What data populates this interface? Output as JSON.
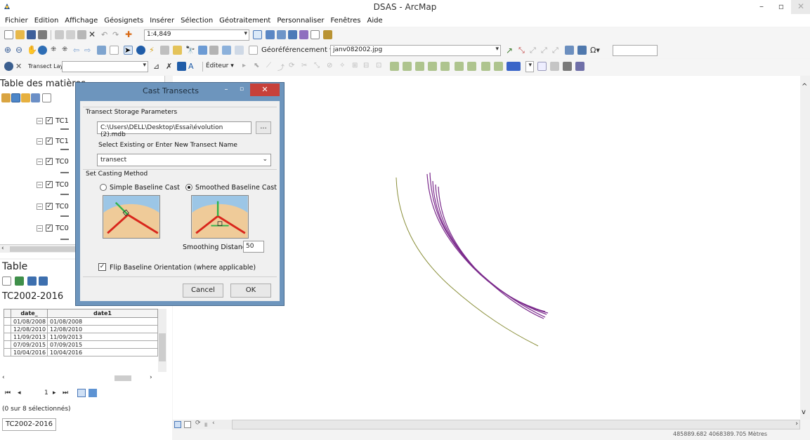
{
  "window": {
    "title": "DSAS - ArcMap",
    "minimize": "–",
    "maximize": "▫",
    "close": "✕"
  },
  "menu": [
    "Fichier",
    "Edition",
    "Affichage",
    "Géosignets",
    "Insérer",
    "Sélection",
    "Géotraitement",
    "Personnaliser",
    "Fenêtres",
    "Aide"
  ],
  "toolbar1": {
    "scale_value": "1:4,849"
  },
  "toolbar2": {
    "georef_label": "Géoréférencement ▾",
    "georef_layer": "janv082002.jpg"
  },
  "toolbar3": {
    "transect_layer_label": "Transect Layer",
    "editor_label": "Éditeur ▾"
  },
  "toc": {
    "title": "Table des matières",
    "layers": [
      "TC1",
      "TC1",
      "TC0",
      "TC0",
      "TC0",
      "TC0"
    ]
  },
  "table": {
    "title": "Table",
    "tab_title": "TC2002-2016",
    "columns": [
      "date_",
      "date1"
    ],
    "rows": [
      [
        "01/08/2008",
        "01/08/2008"
      ],
      [
        "12/08/2010",
        "12/08/2010"
      ],
      [
        "11/09/2013",
        "11/09/2013"
      ],
      [
        "07/09/2015",
        "07/09/2015"
      ],
      [
        "10/04/2016",
        "10/04/2016"
      ]
    ],
    "record_nav": "1",
    "selection_text": "(0 sur 8 sélectionnés)",
    "bottom_tab": "TC2002-2016"
  },
  "dialog": {
    "title": "Cast Transects",
    "storage_section": "Transect Storage Parameters",
    "storage_path": "C:\\Users\\DELL\\Desktop\\Essai\\évolution (2).mdb",
    "browse_label": "...",
    "name_label": "Select Existing or Enter New Transect Name",
    "name_value": "transect",
    "casting_section": "Set Casting Method",
    "simple_label": "Simple Baseline Cast",
    "smoothed_label": "Smoothed Baseline Cast",
    "selected_method": "smoothed",
    "smoothing_label": "Smoothing Distance",
    "smoothing_value": "50",
    "flip_label": "Flip Baseline Orientation (where applicable)",
    "flip_checked": true,
    "cancel_label": "Cancel",
    "ok_label": "OK"
  },
  "map": {
    "coords": "485889.682  4068389.705 Mètres",
    "baseline_color": "#8a8f3a",
    "shoreline_color": "#7b2a8c"
  }
}
